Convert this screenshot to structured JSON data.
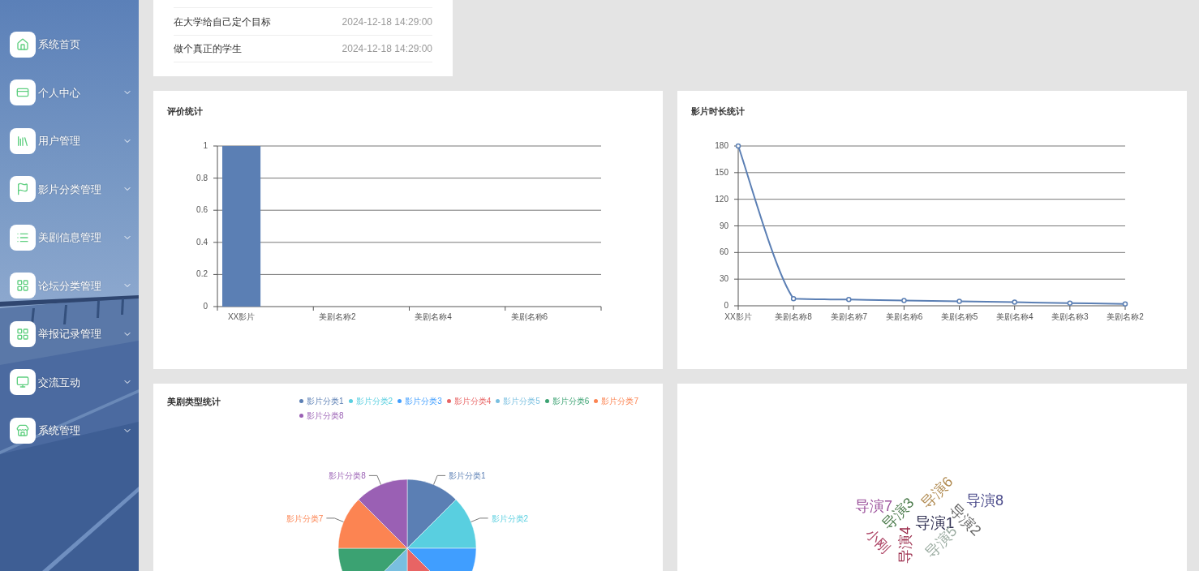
{
  "sidebar": {
    "items": [
      {
        "label": "系统首页",
        "has_submenu": false
      },
      {
        "label": "个人中心",
        "has_submenu": true
      },
      {
        "label": "用户管理",
        "has_submenu": true
      },
      {
        "label": "影片分类管理",
        "has_submenu": true
      },
      {
        "label": "美剧信息管理",
        "has_submenu": true
      },
      {
        "label": "论坛分类管理",
        "has_submenu": true
      },
      {
        "label": "举报记录管理",
        "has_submenu": true
      },
      {
        "label": "交流互动",
        "has_submenu": true
      },
      {
        "label": "系统管理",
        "has_submenu": true
      }
    ]
  },
  "notice_list": {
    "rows": [
      {
        "title": "在大学给自己定个目标",
        "time": "2024-12-18 14:29:00"
      },
      {
        "title": "做个真正的学生",
        "time": "2024-12-18 14:29:00"
      }
    ]
  },
  "rating_card": {
    "title": "评价统计",
    "chart_data": {
      "type": "bar",
      "categories": [
        "XX影片",
        null,
        "美剧名称2",
        null,
        "美剧名称4",
        null,
        "美剧名称6",
        null
      ],
      "values": [
        1,
        0,
        0,
        0,
        0,
        0,
        0,
        0
      ],
      "color": "#5b7fb4",
      "grid": true,
      "ylim": [
        0,
        1
      ],
      "yticks": [
        0,
        0.2,
        0.4,
        0.6,
        0.8,
        1
      ]
    }
  },
  "duration_card": {
    "title": "影片时长统计",
    "chart_data": {
      "type": "line",
      "categories": [
        "XX影片",
        "美剧名称8",
        "美剧名称7",
        "美剧名称6",
        "美剧名称5",
        "美剧名称4",
        "美剧名称3",
        "美剧名称2"
      ],
      "values": [
        180,
        8,
        7,
        6,
        5,
        4,
        3,
        2
      ],
      "color": "#5b7fb4",
      "grid": true,
      "marker": true,
      "ylim": [
        0,
        180
      ],
      "yticks": [
        0,
        30,
        60,
        90,
        120,
        150,
        180
      ]
    }
  },
  "genre_card": {
    "title": "美剧类型统计",
    "legend": [
      {
        "label": "影片分类1",
        "color": "#5b7fb4"
      },
      {
        "label": "影片分类2",
        "color": "#59cfe0"
      },
      {
        "label": "影片分类3",
        "color": "#409eff"
      },
      {
        "label": "影片分类4",
        "color": "#e86464"
      },
      {
        "label": "影片分类5",
        "color": "#79bfe0"
      },
      {
        "label": "影片分类6",
        "color": "#3ba272"
      },
      {
        "label": "影片分类7",
        "color": "#fc8452"
      },
      {
        "label": "影片分类8",
        "color": "#9a60b4"
      }
    ],
    "chart_data": {
      "type": "pie",
      "categories": [
        "影片分类1",
        "影片分类2",
        null,
        null,
        null,
        null,
        "影片分类7",
        "影片分类8"
      ],
      "values": [
        12.5,
        12.5,
        12.5,
        12.5,
        12.5,
        12.5,
        12.5,
        12.5
      ]
    }
  },
  "director_cloud": {
    "words": [
      {
        "text": "导演7",
        "color": "#9a4f9a"
      },
      {
        "text": "导演3",
        "color": "#4a7a4a"
      },
      {
        "text": "导演6",
        "color": "#b08a50"
      },
      {
        "text": "导演8",
        "color": "#4a4a8a"
      },
      {
        "text": "导演1",
        "color": "#333355"
      },
      {
        "text": "导演2",
        "color": "#666666"
      },
      {
        "text": "小刚",
        "color": "#b04a6a"
      },
      {
        "text": "导演4",
        "color": "#9a2a4a"
      },
      {
        "text": "导演5",
        "color": "#9aaba0"
      }
    ]
  }
}
